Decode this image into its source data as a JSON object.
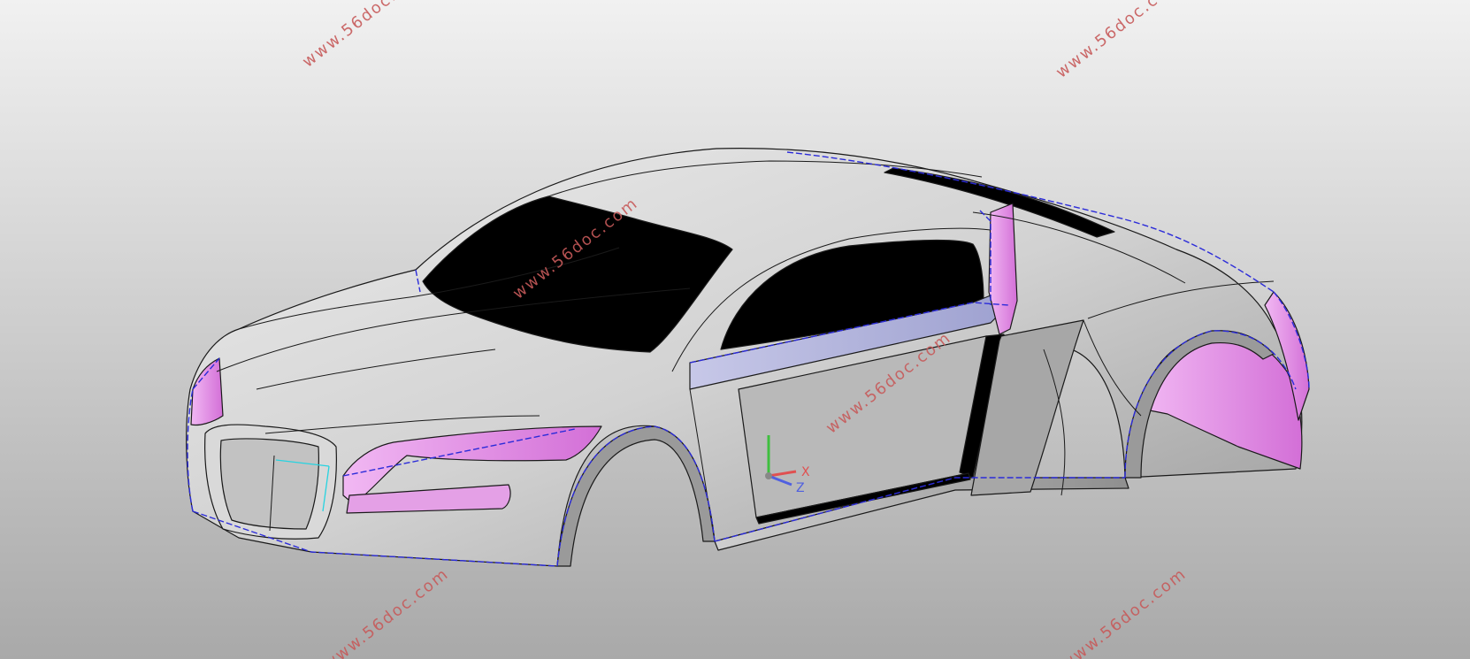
{
  "viewport": {
    "background_top": "#f1f1f1",
    "background_bottom": "#a9a9a9"
  },
  "model": {
    "body_color": "#d6d6d6",
    "glass_color": "#000000",
    "highlight_pink": "#e38ce6",
    "highlight_lavender": "#aeb0d8",
    "edge_color": "#1a1a1a",
    "boundary_dashed_color": "#2b2bd9",
    "sketch_line_color": "#27d3e0"
  },
  "triad": {
    "x_label": "X",
    "z_label": "Z",
    "x_color": "#e05050",
    "y_color": "#3fbf3f",
    "z_color": "#5060e0"
  },
  "watermarks": [
    "www.56doc.com",
    "www.56doc.com",
    "www.56doc.com",
    "www.56doc.com",
    "www.56doc.com",
    "www.56doc.com"
  ]
}
